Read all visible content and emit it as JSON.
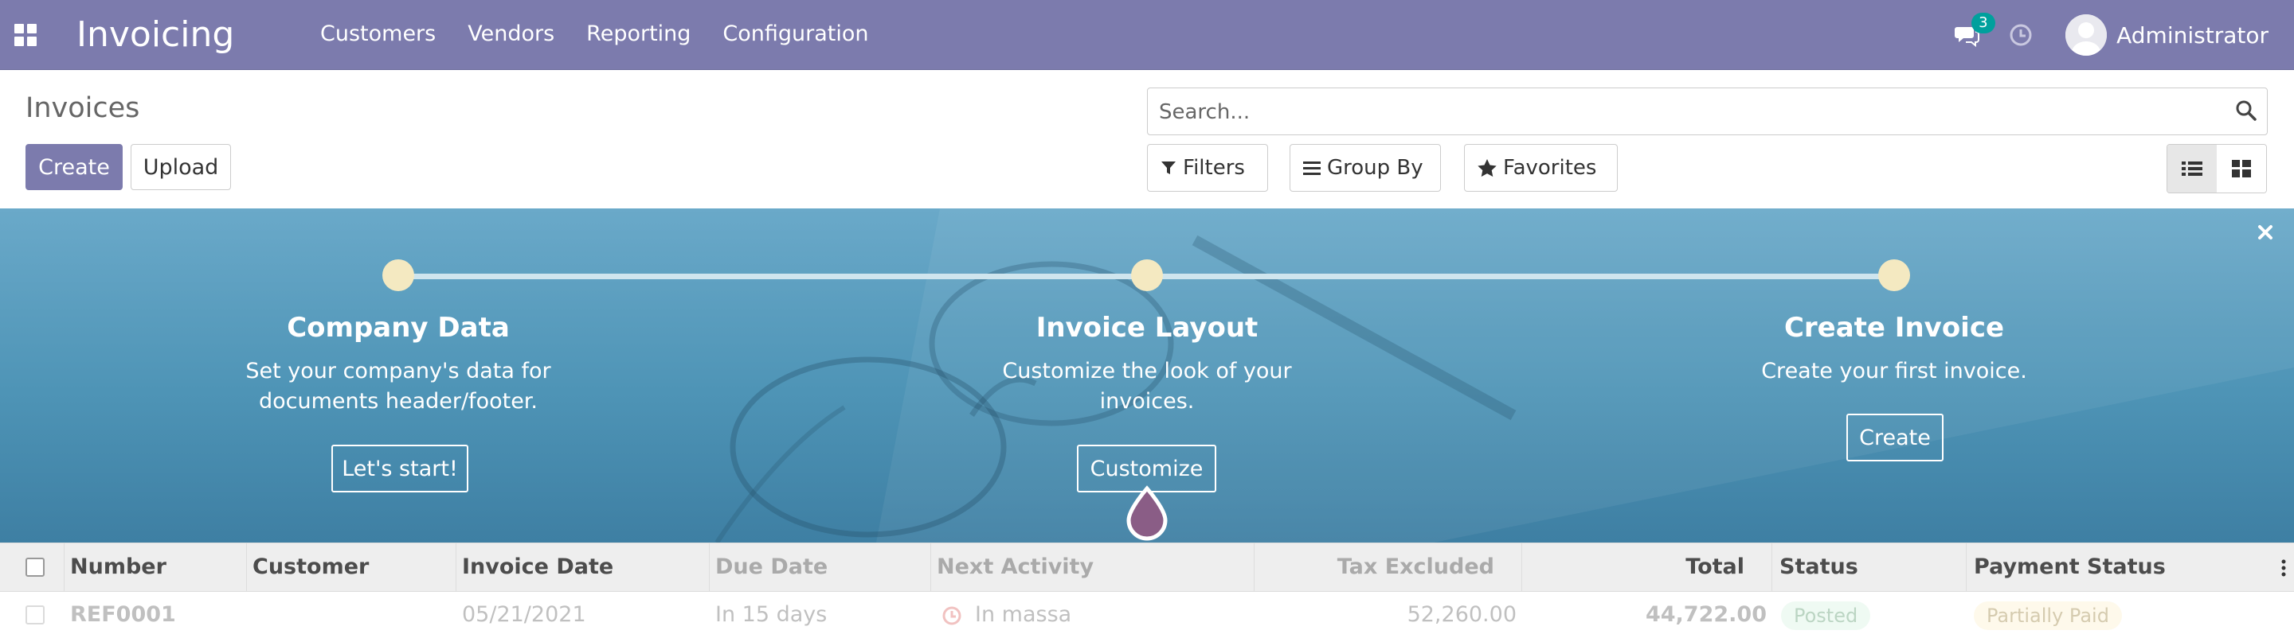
{
  "navbar": {
    "app_title": "Invoicing",
    "menu": [
      "Customers",
      "Vendors",
      "Reporting",
      "Configuration"
    ],
    "messages_count": "3",
    "user": "Administrator"
  },
  "control_panel": {
    "title": "Invoices",
    "create_label": "Create",
    "upload_label": "Upload",
    "search_placeholder": "Search...",
    "filters_label": "Filters",
    "group_by_label": "Group By",
    "favorites_label": "Favorites"
  },
  "banner": {
    "steps": [
      {
        "title": "Company Data",
        "desc_line1": "Set your company's data for",
        "desc_line2": "documents header/footer.",
        "button": "Let's start!"
      },
      {
        "title": "Invoice Layout",
        "desc_line1": "Customize the look of your",
        "desc_line2": "invoices.",
        "button": "Customize"
      },
      {
        "title": "Create Invoice",
        "desc_line1": "Create your first invoice.",
        "desc_line2": "",
        "button": "Create"
      }
    ],
    "colors": {
      "dot": "#f4e9c1",
      "marker": "#8a5d86"
    }
  },
  "table": {
    "columns": [
      "Number",
      "Customer",
      "Invoice Date",
      "Due Date",
      "Next Activity",
      "Tax Excluded",
      "Total",
      "Status",
      "Payment Status"
    ],
    "rows": [
      {
        "number": "REF0001",
        "customer": "",
        "invoice_date": "05/21/2021",
        "due_date": "In 15 days",
        "next_activity": "In massa",
        "tax_excluded": "52,260.00",
        "total": "44,722.00",
        "status": "Posted",
        "payment_status": "Partially Paid"
      }
    ]
  },
  "colors": {
    "brand": "#7c7bad",
    "status_posted": "#d4f1dd",
    "payment_partial": "#fdf0c8"
  }
}
